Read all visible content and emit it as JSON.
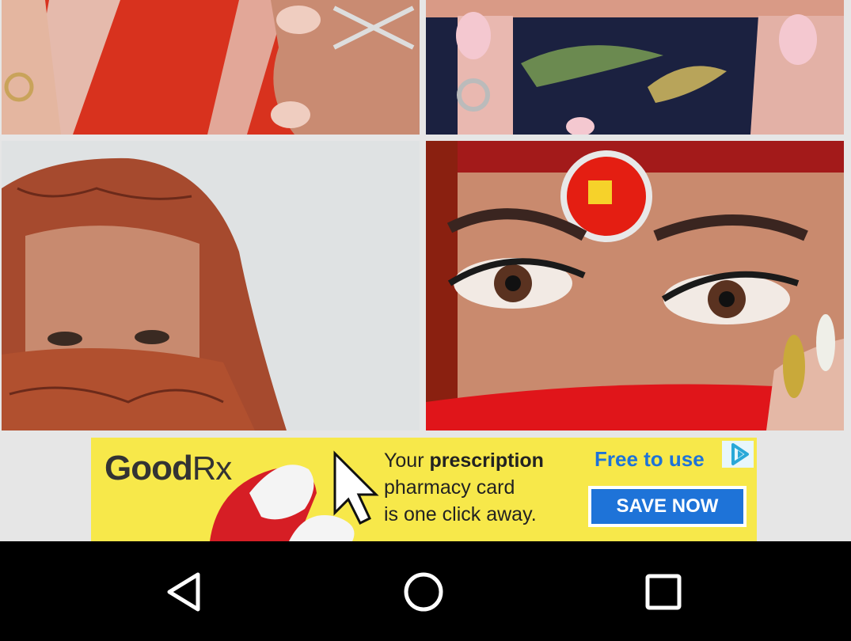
{
  "gallery": {
    "images": [
      {
        "name": "hands-with-rings-on-red-fabric"
      },
      {
        "name": "face-covered-with-dark-scarf-pink-nails"
      },
      {
        "name": "woman-in-rust-headscarf"
      },
      {
        "name": "eyes-with-red-jewel-headpiece"
      }
    ]
  },
  "ad": {
    "brand": "Good",
    "brand_rx": "Rx",
    "line1_prefix": "Your ",
    "line1_bold": "prescription",
    "line2": "pharmacy card",
    "line3": "is one click away.",
    "free_label": "Free to use",
    "cta": "SAVE NOW",
    "colors": {
      "background": "#f7e84a",
      "accent": "#1e73d8"
    }
  },
  "navbar": {
    "back": "back-icon",
    "home": "home-icon",
    "recent": "recent-apps-icon"
  }
}
